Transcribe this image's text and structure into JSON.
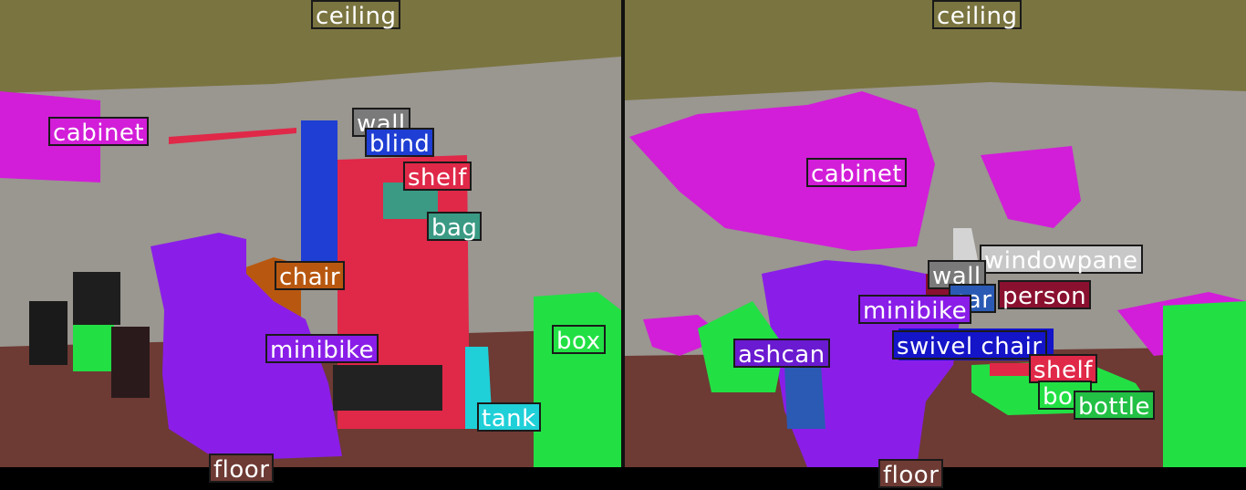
{
  "colors": {
    "ceiling": "#7a7440",
    "cabinet": "#d21ed8",
    "wall": "#7a7a7a",
    "blind": "#1e3ed4",
    "shelf": "#e02848",
    "bag": "#3a9a84",
    "chair": "#b85810",
    "minibike": "#8a1ee8",
    "box": "#22e044",
    "tank": "#20d0d8",
    "floor": "#6e3a34",
    "windowpane": "#c8c8c8",
    "car": "#2a5ab4",
    "person": "#8a1030",
    "swivel_chair": "#1414c8",
    "ashcan": "#6a1ad0",
    "bottle": "#22c044"
  },
  "left_labels": [
    "ceiling",
    "cabinet",
    "wall",
    "blind",
    "shelf",
    "bag",
    "chair",
    "minibike",
    "box",
    "tank",
    "floor"
  ],
  "right_labels": [
    "ceiling",
    "cabinet",
    "windowpane",
    "wall",
    "car",
    "person",
    "minibike",
    "swivel chair",
    "ashcan",
    "shelf",
    "box",
    "bottle",
    "floor"
  ]
}
